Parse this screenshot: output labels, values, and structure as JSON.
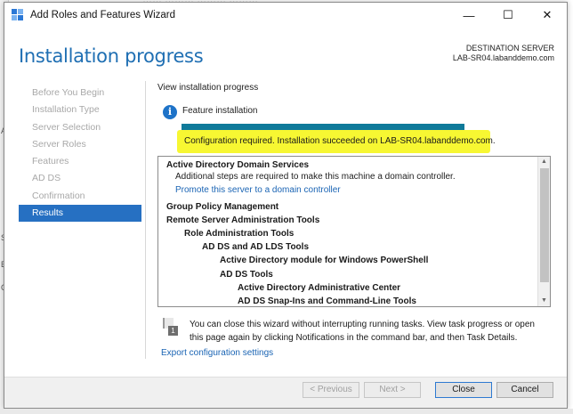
{
  "background": {
    "top_text": "…… ……… ……… ………",
    "left_letters": [
      "A",
      "S",
      "E",
      "C"
    ]
  },
  "window": {
    "title": "Add Roles and Features Wizard",
    "controls": {
      "minimize": "—",
      "maximize": "☐",
      "close": "✕"
    }
  },
  "header": {
    "page_title": "Installation progress",
    "destination_label": "DESTINATION SERVER",
    "destination_server": "LAB-SR04.labanddemo.com"
  },
  "nav": {
    "items": [
      {
        "label": "Before You Begin",
        "active": false
      },
      {
        "label": "Installation Type",
        "active": false
      },
      {
        "label": "Server Selection",
        "active": false
      },
      {
        "label": "Server Roles",
        "active": false
      },
      {
        "label": "Features",
        "active": false
      },
      {
        "label": "AD DS",
        "active": false
      },
      {
        "label": "Confirmation",
        "active": false
      },
      {
        "label": "Results",
        "active": true
      }
    ]
  },
  "main": {
    "view_label": "View installation progress",
    "feature_label": "Feature installation",
    "progress_fraction": 1.0,
    "status_text": "Configuration required. Installation succeeded on LAB-SR04.labanddemo.com.",
    "results": {
      "ad_ds": "Active Directory Domain Services",
      "ad_ds_note": "Additional steps are required to make this machine a domain controller.",
      "promote_link": "Promote this server to a domain controller",
      "gpm": "Group Policy Management",
      "rsat": "Remote Server Administration Tools",
      "role_admin": "Role Administration Tools",
      "ad_lds_tools": "AD DS and AD LDS Tools",
      "ps_module": "Active Directory module for Windows PowerShell",
      "ad_ds_tools": "AD DS Tools",
      "admin_center": "Active Directory Administrative Center",
      "snapins": "AD DS Snap-Ins and Command-Line Tools"
    },
    "notice_badge": "1",
    "notice_text": "You can close this wizard without interrupting running tasks. View task progress or open this page again by clicking Notifications in the command bar, and then Task Details.",
    "export_link": "Export configuration settings"
  },
  "footer": {
    "previous": "< Previous",
    "next": "Next >",
    "close": "Close",
    "cancel": "Cancel"
  },
  "colors": {
    "accent": "#2670c2",
    "title_blue": "#1f6fb3",
    "progress": "#0f7a9a",
    "highlight": "#f7f732",
    "link": "#1a64b4"
  }
}
